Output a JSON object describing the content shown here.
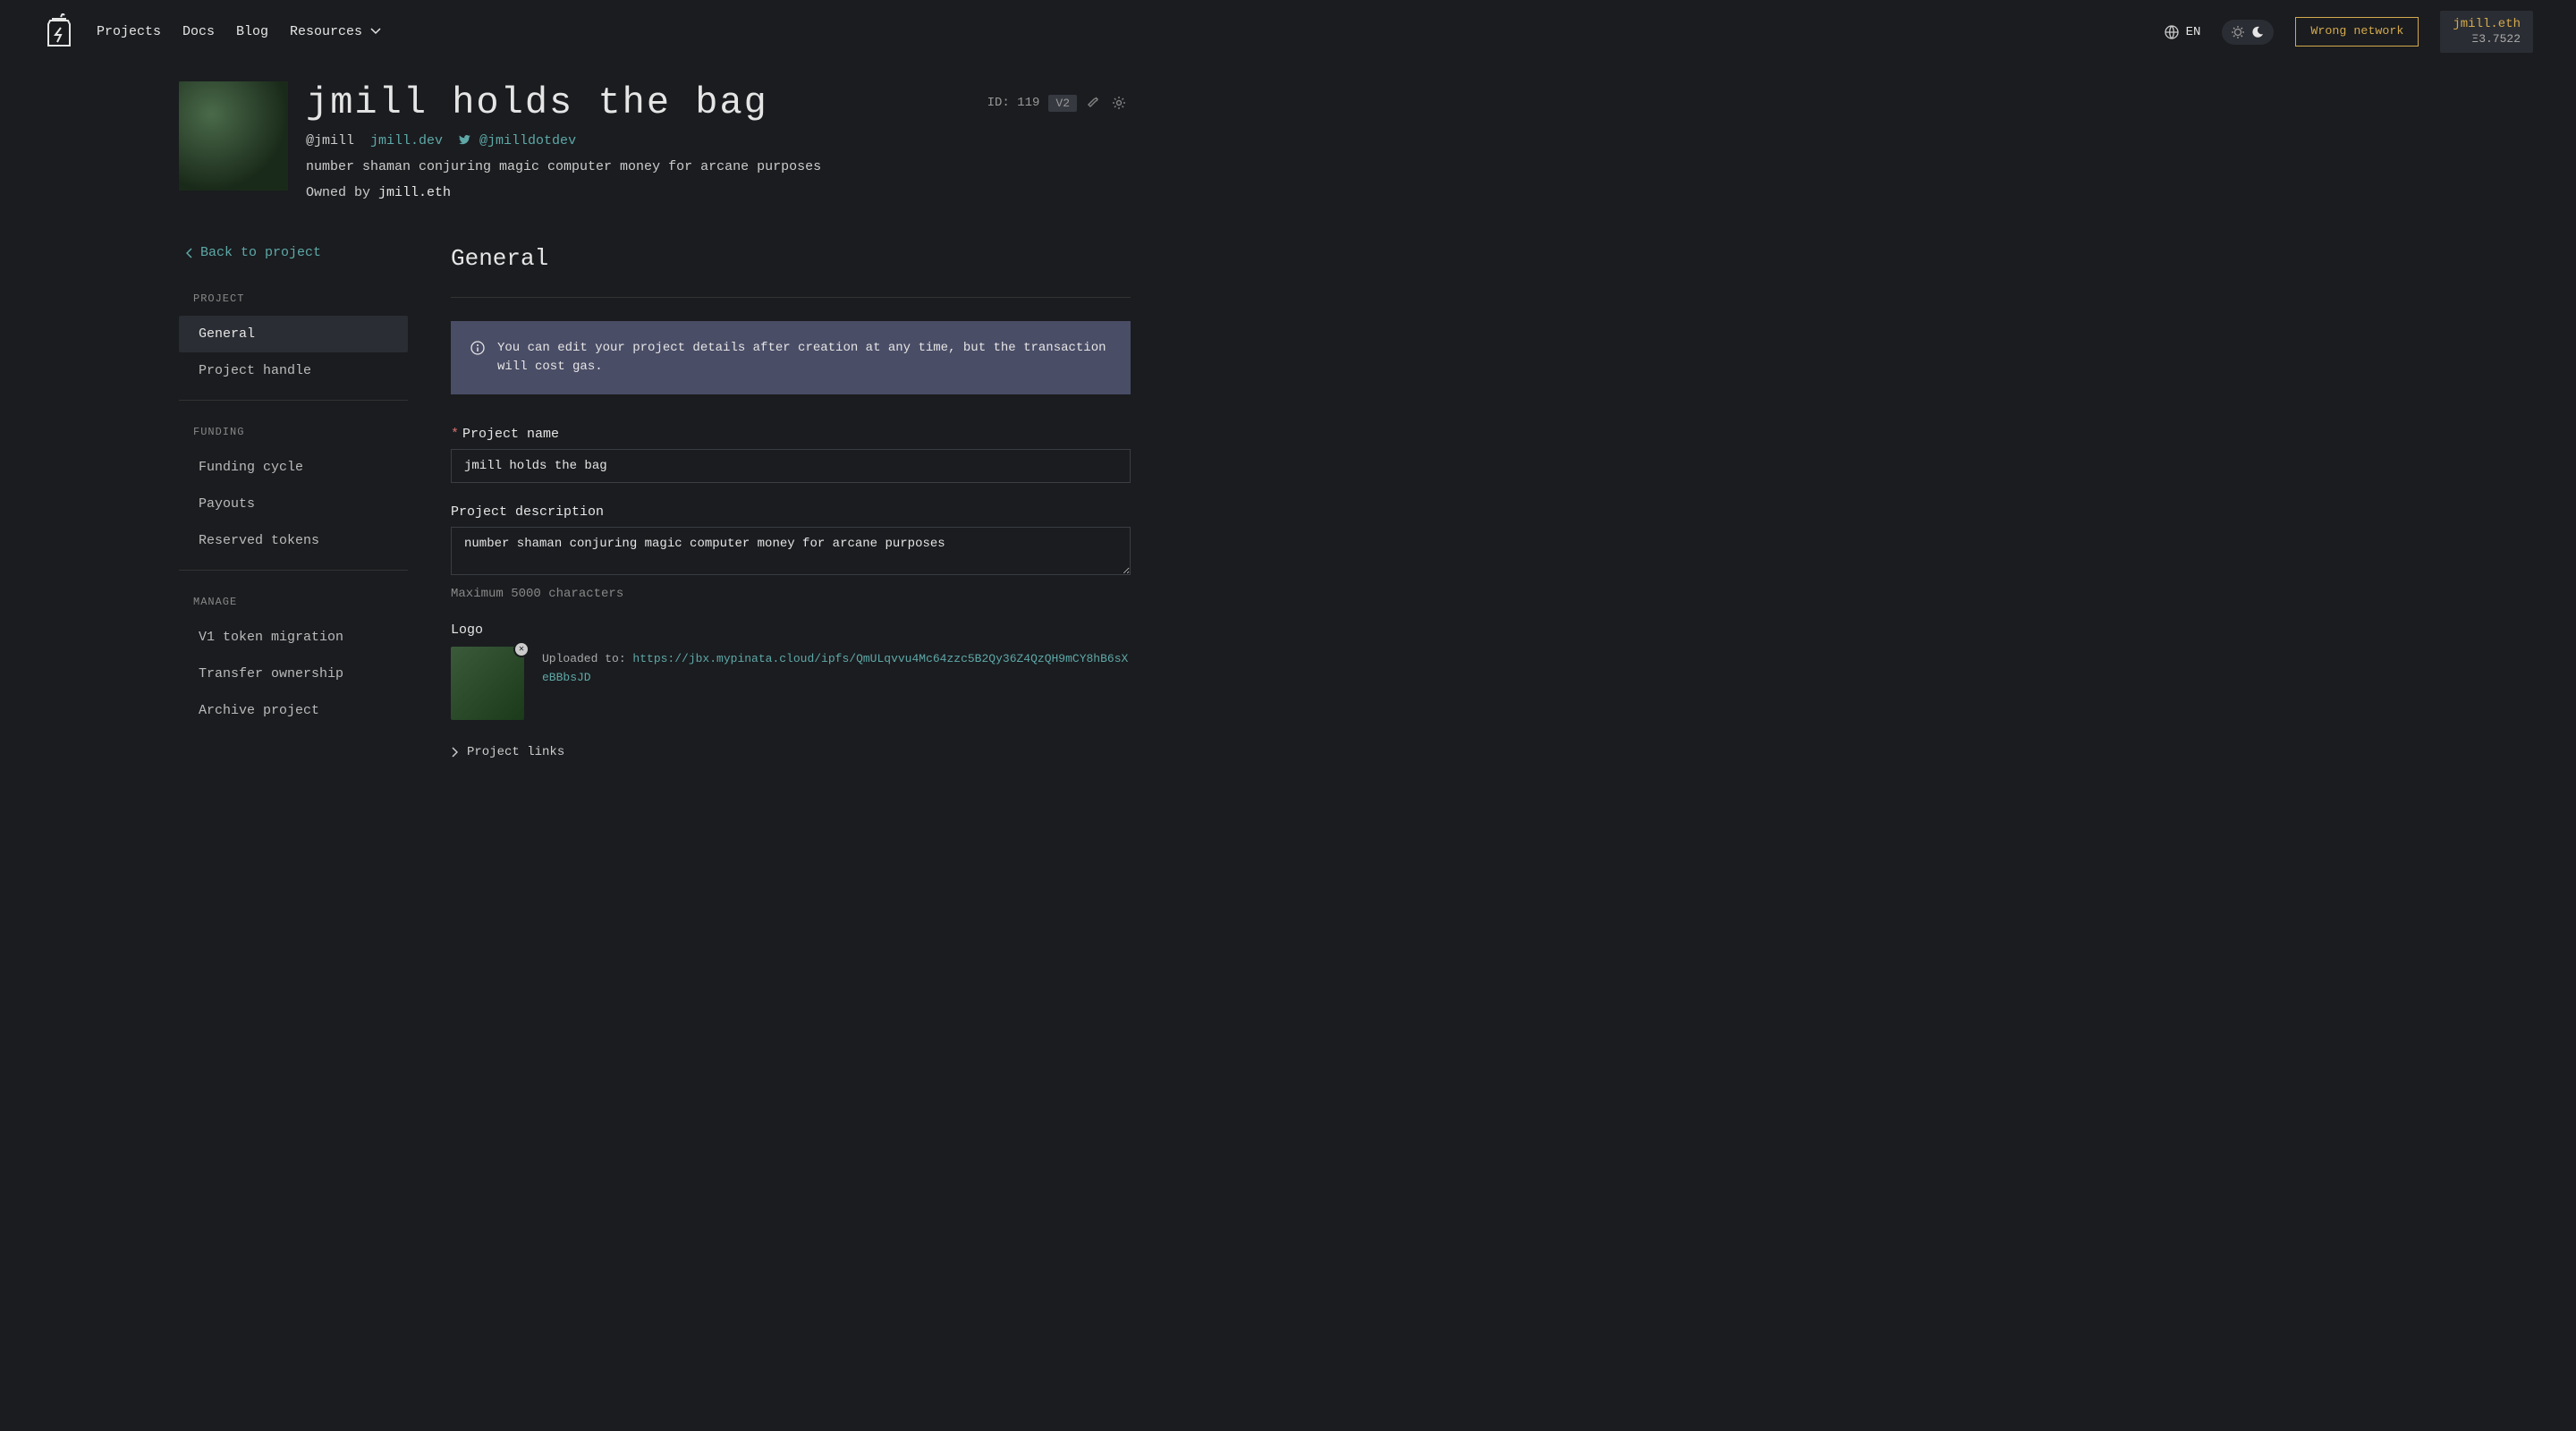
{
  "nav": {
    "projects": "Projects",
    "docs": "Docs",
    "blog": "Blog",
    "resources": "Resources",
    "lang": "EN",
    "wrong_network": "Wrong network",
    "wallet_addr": "jmill.eth",
    "wallet_balance": "Ξ3.7522"
  },
  "header": {
    "title": "jmill holds the bag",
    "id_label": "ID: 119",
    "version_badge": "V2",
    "handle": "@jmill",
    "website": "jmill.dev",
    "twitter": "@jmilldotdev",
    "bio": "number shaman conjuring magic computer money for arcane purposes",
    "owner_prefix": "Owned by ",
    "owner_addr": "jmill.eth"
  },
  "sidebar": {
    "back_label": "Back to project",
    "sections": {
      "project": {
        "label": "PROJECT",
        "items": [
          "General",
          "Project handle"
        ]
      },
      "funding": {
        "label": "FUNDING",
        "items": [
          "Funding cycle",
          "Payouts",
          "Reserved tokens"
        ]
      },
      "manage": {
        "label": "MANAGE",
        "items": [
          "V1 token migration",
          "Transfer ownership",
          "Archive project"
        ]
      }
    }
  },
  "main": {
    "title": "General",
    "info_banner": "You can edit your project details after creation at any time, but the transaction will cost gas.",
    "project_name_label": "Project name",
    "project_name_value": "jmill holds the bag",
    "description_label": "Project description",
    "description_value": "number shaman conjuring magic computer money for arcane purposes",
    "description_help": "Maximum 5000 characters",
    "logo_label": "Logo",
    "upload_prefix": "Uploaded to: ",
    "upload_url": "https://jbx.mypinata.cloud/ipfs/QmULqvvu4Mc64zzc5B2Qy36Z4QzQH9mCY8hB6sXeBBbsJD",
    "project_links_label": "Project links"
  }
}
